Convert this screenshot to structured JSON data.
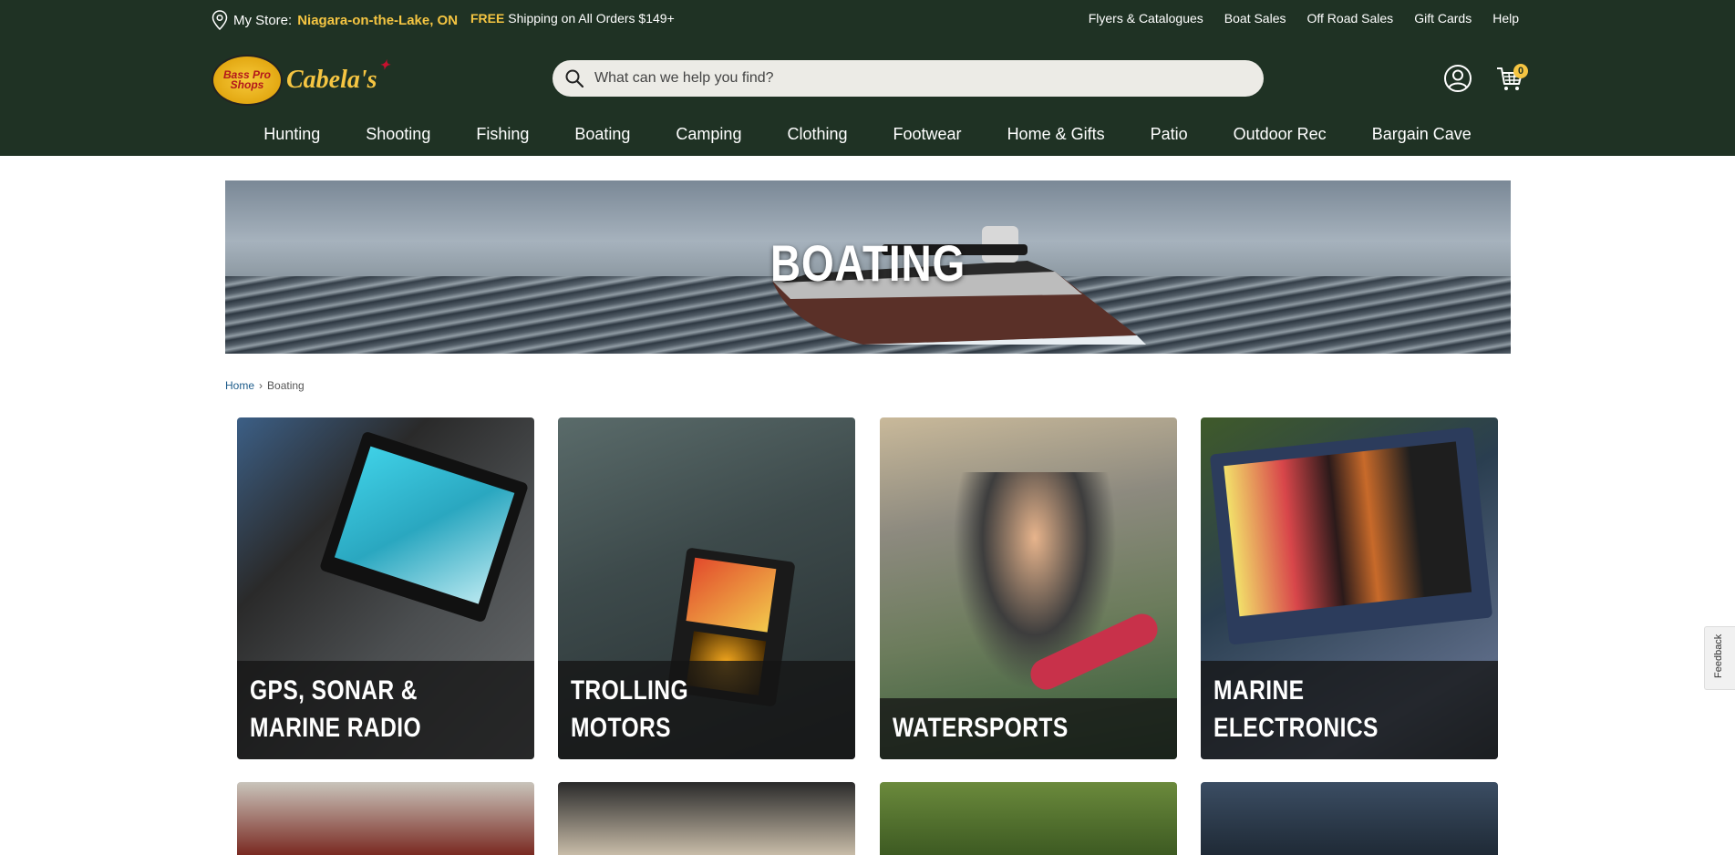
{
  "topbar": {
    "store_label": "My Store:",
    "store_name": "Niagara-on-the-Lake, ON",
    "free_label": "FREE",
    "shipping_text": "Shipping on All Orders $149+",
    "links": [
      "Flyers & Catalogues",
      "Boat Sales",
      "Off Road Sales",
      "Gift Cards",
      "Help"
    ]
  },
  "logo": {
    "bps_text": "Bass Pro Shops",
    "cabelas_text": "Cabela's"
  },
  "search": {
    "placeholder": "What can we help you find?"
  },
  "cart": {
    "count": "0"
  },
  "nav": {
    "items": [
      "Hunting",
      "Shooting",
      "Fishing",
      "Boating",
      "Camping",
      "Clothing",
      "Footwear",
      "Home & Gifts",
      "Patio",
      "Outdoor Rec",
      "Bargain Cave"
    ]
  },
  "hero": {
    "title": "BOATING"
  },
  "breadcrumb": {
    "home": "Home",
    "separator": "›",
    "current": "Boating"
  },
  "categories": [
    {
      "label": "GPS, SONAR & MARINE RADIO"
    },
    {
      "label": "TROLLING MOTORS"
    },
    {
      "label": "WATERSPORTS"
    },
    {
      "label": "MARINE ELECTRONICS"
    }
  ],
  "feedback": {
    "label": "Feedback"
  },
  "colors": {
    "header_bg": "#1f3224",
    "accent": "#f5c542",
    "link": "#1c5b8a"
  },
  "icons": [
    "location-pin-icon",
    "search-icon",
    "account-icon",
    "cart-icon"
  ]
}
